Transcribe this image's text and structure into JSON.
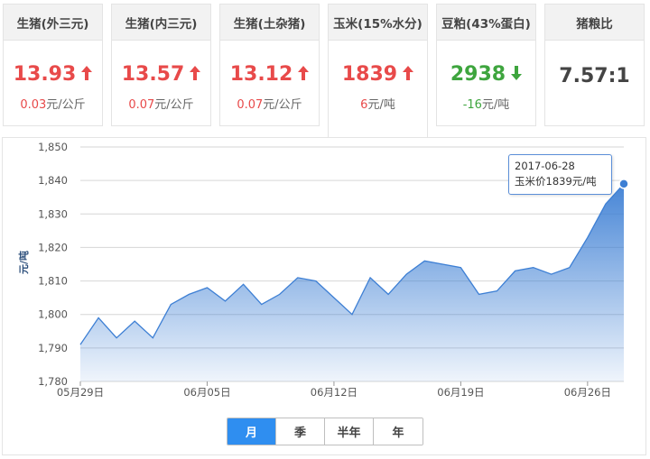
{
  "cards": [
    {
      "title": "生猪(外三元)",
      "value": "13.93",
      "change": "0.03",
      "unit": "元/公斤",
      "trend": "up"
    },
    {
      "title": "生猪(内三元)",
      "value": "13.57",
      "change": "0.07",
      "unit": "元/公斤",
      "trend": "up"
    },
    {
      "title": "生猪(土杂猪)",
      "value": "13.12",
      "change": "0.07",
      "unit": "元/公斤",
      "trend": "up"
    },
    {
      "title": "玉米(15%水分)",
      "value": "1839",
      "change": "6",
      "unit": "元/吨",
      "trend": "up"
    },
    {
      "title": "豆粕(43%蛋白)",
      "value": "2938",
      "change": "-16",
      "unit": "元/吨",
      "trend": "down"
    },
    {
      "title": "猪粮比",
      "value": "7.57:1",
      "change": "",
      "unit": "",
      "trend": "neutral"
    }
  ],
  "colors": {
    "up": "#e84a4a",
    "down": "#3ea53e",
    "accent": "#2f8ef0",
    "line": "#3d7fd4"
  },
  "tooltip": {
    "date": "2017-06-28",
    "label": "玉米价1839元/吨"
  },
  "periods": [
    "月",
    "季",
    "半年",
    "年"
  ],
  "selected_period": "月",
  "chart_data": {
    "type": "area",
    "title": "",
    "xlabel": "",
    "ylabel": "元/吨",
    "ylim": [
      1780,
      1850
    ],
    "yticks": [
      1780,
      1790,
      1800,
      1810,
      1820,
      1830,
      1840,
      1850
    ],
    "ytick_labels": [
      "1,780",
      "1,790",
      "1,800",
      "1,810",
      "1,820",
      "1,830",
      "1,840",
      "1,850"
    ],
    "xticks": [
      "05月29日",
      "06月05日",
      "06月12日",
      "06月19日",
      "06月26日"
    ],
    "grid": true,
    "series": [
      {
        "x": [
          "2017-05-29",
          "2017-05-30",
          "2017-05-31",
          "2017-06-01",
          "2017-06-02",
          "2017-06-03",
          "2017-06-04",
          "2017-06-05",
          "2017-06-06",
          "2017-06-07",
          "2017-06-08",
          "2017-06-09",
          "2017-06-10",
          "2017-06-11",
          "2017-06-12",
          "2017-06-13",
          "2017-06-14",
          "2017-06-15",
          "2017-06-16",
          "2017-06-17",
          "2017-06-18",
          "2017-06-19",
          "2017-06-20",
          "2017-06-21",
          "2017-06-22",
          "2017-06-23",
          "2017-06-24",
          "2017-06-25",
          "2017-06-26",
          "2017-06-27",
          "2017-06-28"
        ],
        "values": [
          1791,
          1799,
          1793,
          1798,
          1793,
          1803,
          1806,
          1808,
          1804,
          1809,
          1803,
          1806,
          1811,
          1810,
          1805,
          1800,
          1811,
          1806,
          1812,
          1816,
          1815,
          1814,
          1806,
          1807,
          1813,
          1814,
          1812,
          1814,
          1823,
          1833,
          1839
        ]
      }
    ]
  }
}
